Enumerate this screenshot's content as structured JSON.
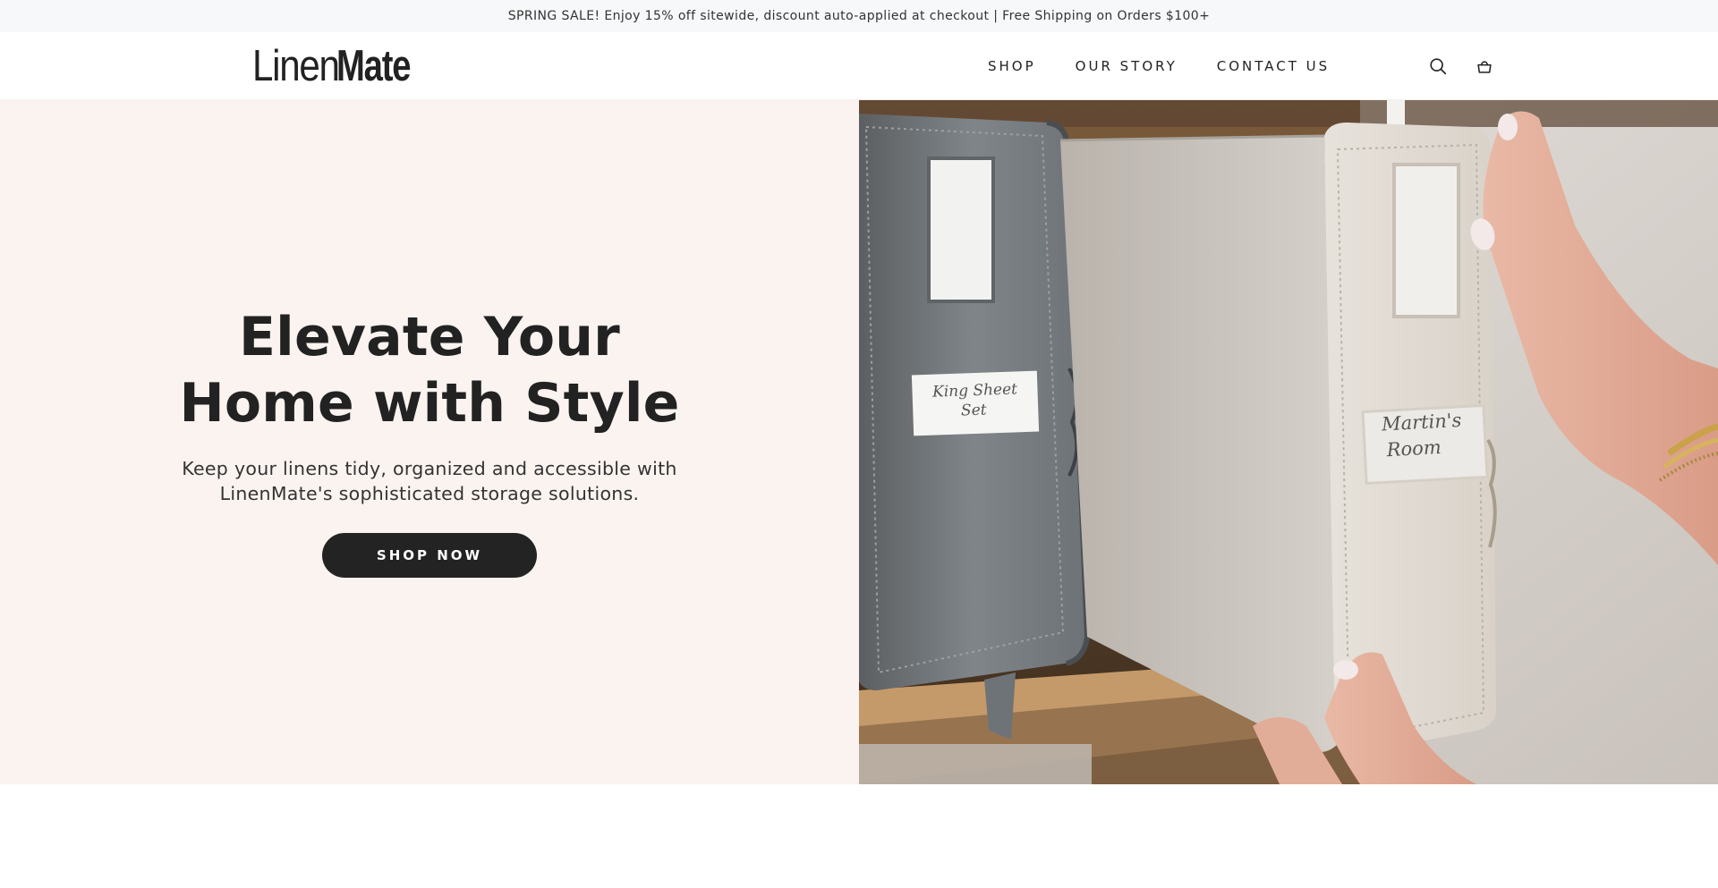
{
  "announcement": {
    "text": "SPRING SALE! Enjoy 15% off sitewide, discount auto-applied at checkout | Free Shipping on Orders $100+"
  },
  "header": {
    "logo_light": "Linen",
    "logo_bold": "Mate",
    "nav": [
      {
        "label": "SHOP"
      },
      {
        "label": "OUR STORY"
      },
      {
        "label": "CONTACT US"
      }
    ],
    "icons": {
      "search": "search-icon",
      "cart": "shopping-bag-icon"
    }
  },
  "hero": {
    "title_line1": "Elevate Your",
    "title_line2": "Home with Style",
    "subtitle_line1": "Keep your linens tidy, organized and accessible with",
    "subtitle_line2": "LinenMate's sophisticated storage solutions.",
    "cta_label": "SHOP NOW",
    "image": {
      "label_left_line1": "King Sheet",
      "label_left_line2": "Set",
      "label_right_line1": "Martin's",
      "label_right_line2": "Room"
    }
  },
  "colors": {
    "announcement_bg": "#f7f8fa",
    "hero_bg": "#fbf3f0",
    "button_bg": "#232323",
    "text": "#222222"
  }
}
